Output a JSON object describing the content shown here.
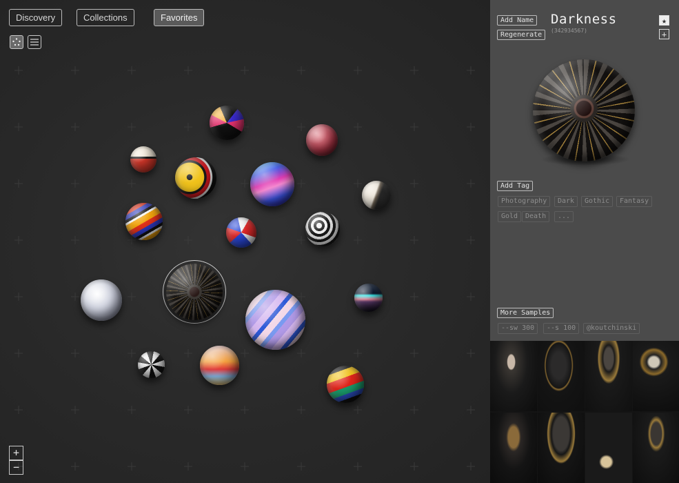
{
  "nav": {
    "tabs": [
      {
        "label": "Discovery",
        "active": false
      },
      {
        "label": "Collections",
        "active": false
      },
      {
        "label": "Favorites",
        "active": true
      }
    ]
  },
  "view_toggle": {
    "options": [
      "scatter-view-icon",
      "list-view-icon"
    ],
    "selected": "scatter-view-icon"
  },
  "zoom": {
    "in": "+",
    "out": "−"
  },
  "spheres": [
    {
      "name": "rainbow-stripe-sphere",
      "colors": [
        "#1b1b1b",
        "#e8336f",
        "#f5b13b",
        "#3a2ad0"
      ]
    },
    {
      "name": "red-leather-sphere",
      "colors": [
        "#d86a74",
        "#9a2d3a",
        "#5a1620"
      ]
    },
    {
      "name": "red-cream-sphere",
      "colors": [
        "#f4ead8",
        "#d6392a",
        "#2a2a2a"
      ]
    },
    {
      "name": "yellow-eye-sphere",
      "colors": [
        "#f0c21a",
        "#c8161c",
        "#111111"
      ]
    },
    {
      "name": "blue-wave-sphere",
      "colors": [
        "#3d56e8",
        "#e23fb5",
        "#5ad0f2"
      ]
    },
    {
      "name": "marble-sphere",
      "colors": [
        "#e9e4da",
        "#8a7a6a",
        "#2b2b2b"
      ]
    },
    {
      "name": "orange-wave-sphere",
      "colors": [
        "#f2a40c",
        "#e2311a",
        "#2b37b8"
      ]
    },
    {
      "name": "red-blue-sphere",
      "colors": [
        "#e42a2a",
        "#2a48d8",
        "#f4f4f4"
      ]
    },
    {
      "name": "zebra-swirl-sphere",
      "colors": [
        "#f2f2f2",
        "#1a1a1a",
        "#d83a40"
      ]
    },
    {
      "name": "pearl-sphere",
      "colors": [
        "#e6e8ee",
        "#a4a8b8",
        "#6e7080"
      ]
    },
    {
      "name": "darkness-sphere",
      "colors": [
        "#3a3632",
        "#161412",
        "#a8823c"
      ]
    },
    {
      "name": "pastel-stripe-sphere",
      "colors": [
        "#c7a8ea",
        "#2f5ad8",
        "#f3d8e8"
      ]
    },
    {
      "name": "horizon-sphere",
      "colors": [
        "#1a2a4a",
        "#e68a9c",
        "#3af0f0"
      ]
    },
    {
      "name": "black-white-sphere",
      "colors": [
        "#f2f2f2",
        "#111111",
        "#777777"
      ]
    },
    {
      "name": "fire-glass-sphere",
      "colors": [
        "#f6a340",
        "#e23c3c",
        "#8cc0f0"
      ]
    },
    {
      "name": "neon-stripe-sphere",
      "colors": [
        "#f2c21a",
        "#e0241a",
        "#1a9a6a"
      ]
    }
  ],
  "selection": {
    "name": "Darkness",
    "seed": "(342934567)",
    "add_name_label": "Add Name",
    "regenerate_label": "Regenerate",
    "add_tag_label": "Add Tag",
    "tags": [
      "Photography",
      "Dark",
      "Gothic",
      "Fantasy",
      "Gold",
      "Death",
      "..."
    ],
    "more_samples_label": "More Samples",
    "params": [
      "--sw 300",
      "--s 100",
      "@koutchinski"
    ],
    "favorite_icon": "star-icon",
    "add_icon": "plus-icon"
  },
  "samples": [
    "hooded-woman-portrait",
    "dark-raven",
    "skeletal-figure",
    "hooded-skull",
    "masked-hood-figure",
    "dark-toad-creature",
    "figure-with-orb",
    "gold-masked-figure"
  ],
  "colors": {
    "canvas_bg": "#2b2b2b",
    "panel_bg": "#4b4b4b",
    "border": "#bdbdbd",
    "gold": "#b08a3e"
  }
}
